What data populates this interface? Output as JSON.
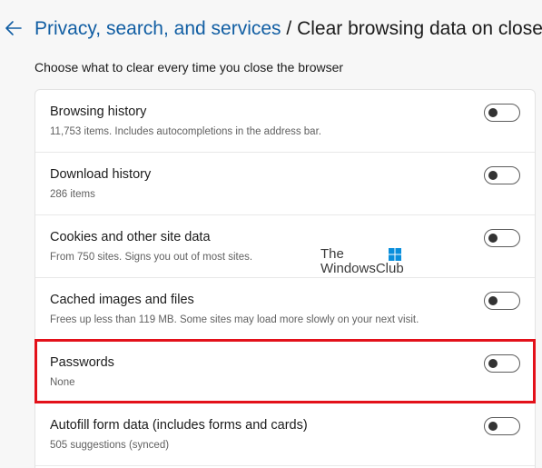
{
  "header": {
    "back_icon": "arrow-left-icon",
    "breadcrumb_link": "Privacy, search, and services",
    "separator": " / ",
    "title": "Clear browsing data on close"
  },
  "subtitle": "Choose what to clear every time you close the browser",
  "settings": [
    {
      "label": "Browsing history",
      "description": "11,753 items. Includes autocompletions in the address bar.",
      "enabled": false
    },
    {
      "label": "Download history",
      "description": "286 items",
      "enabled": false
    },
    {
      "label": "Cookies and other site data",
      "description": "From 750 sites. Signs you out of most sites.",
      "enabled": false
    },
    {
      "label": "Cached images and files",
      "description": "Frees up less than 119 MB. Some sites may load more slowly on your next visit.",
      "enabled": false
    },
    {
      "label": "Passwords",
      "description": "None",
      "enabled": false
    },
    {
      "label": "Autofill form data (includes forms and cards)",
      "description": "505 suggestions (synced)",
      "enabled": false
    }
  ],
  "watermark": {
    "line1": "The",
    "line2": "WindowsClub",
    "logo_icon": "windows-logo-icon"
  },
  "colors": {
    "accent": "#115ea3",
    "highlight_border": "#e3111a",
    "toggle_off_border": "#5c5c5c"
  }
}
